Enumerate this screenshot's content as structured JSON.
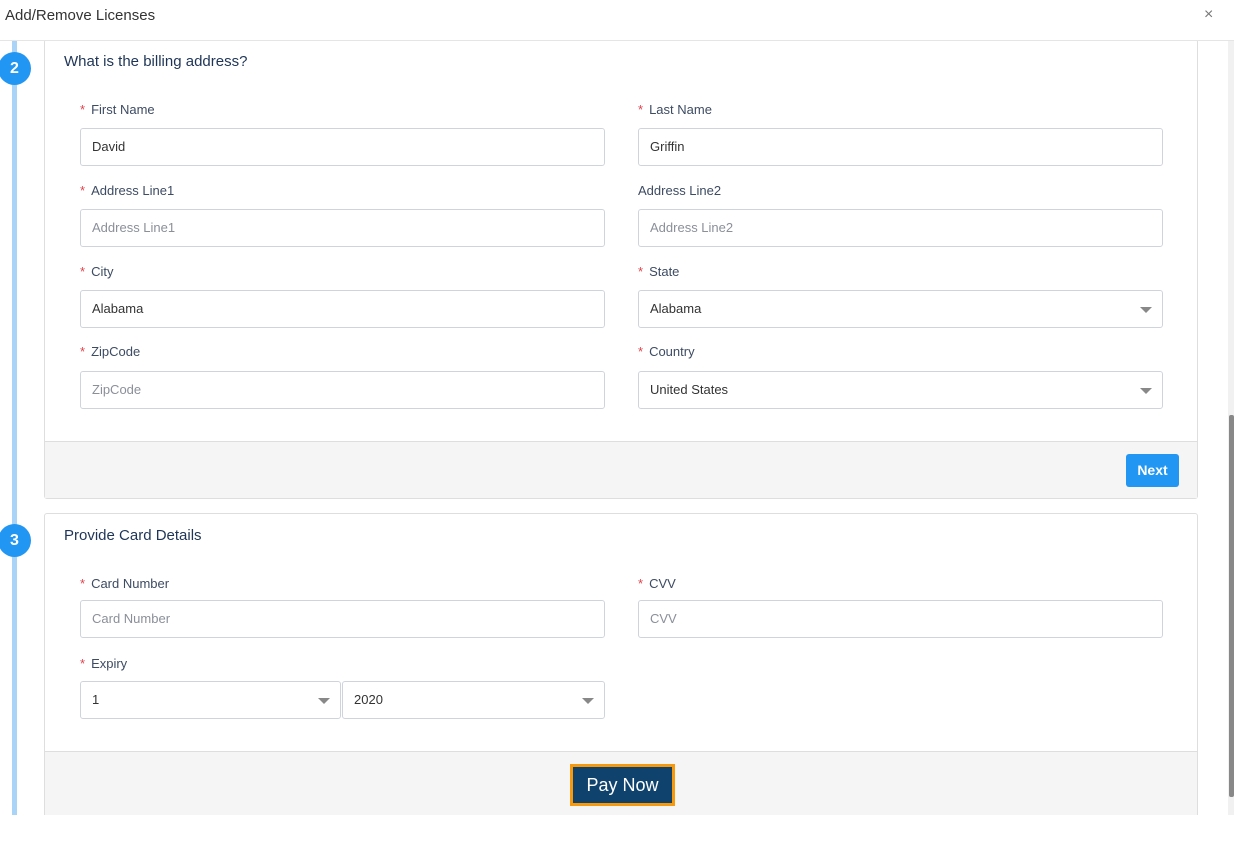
{
  "dialog": {
    "title": "Add/Remove Licenses",
    "close_label": "×"
  },
  "step2": {
    "number": "2",
    "heading": "What is the billing address?",
    "first_name": {
      "label": "First Name",
      "value": "David"
    },
    "last_name": {
      "label": "Last Name",
      "value": "Griffin"
    },
    "address1": {
      "label": "Address Line1",
      "placeholder": "Address Line1"
    },
    "address2": {
      "label": "Address Line2",
      "placeholder": "Address Line2"
    },
    "city": {
      "label": "City",
      "value": "Alabama"
    },
    "state": {
      "label": "State",
      "value": "Alabama"
    },
    "zip": {
      "label": "ZipCode",
      "placeholder": "ZipCode"
    },
    "country": {
      "label": "Country",
      "value": "United States"
    },
    "next_label": "Next"
  },
  "step3": {
    "number": "3",
    "heading": "Provide Card Details",
    "card_number": {
      "label": "Card Number",
      "placeholder": "Card Number"
    },
    "cvv": {
      "label": "CVV",
      "placeholder": "CVV"
    },
    "expiry": {
      "label": "Expiry",
      "month": "1",
      "year": "2020"
    },
    "pay_label": "Pay Now"
  },
  "required_mark": "*"
}
